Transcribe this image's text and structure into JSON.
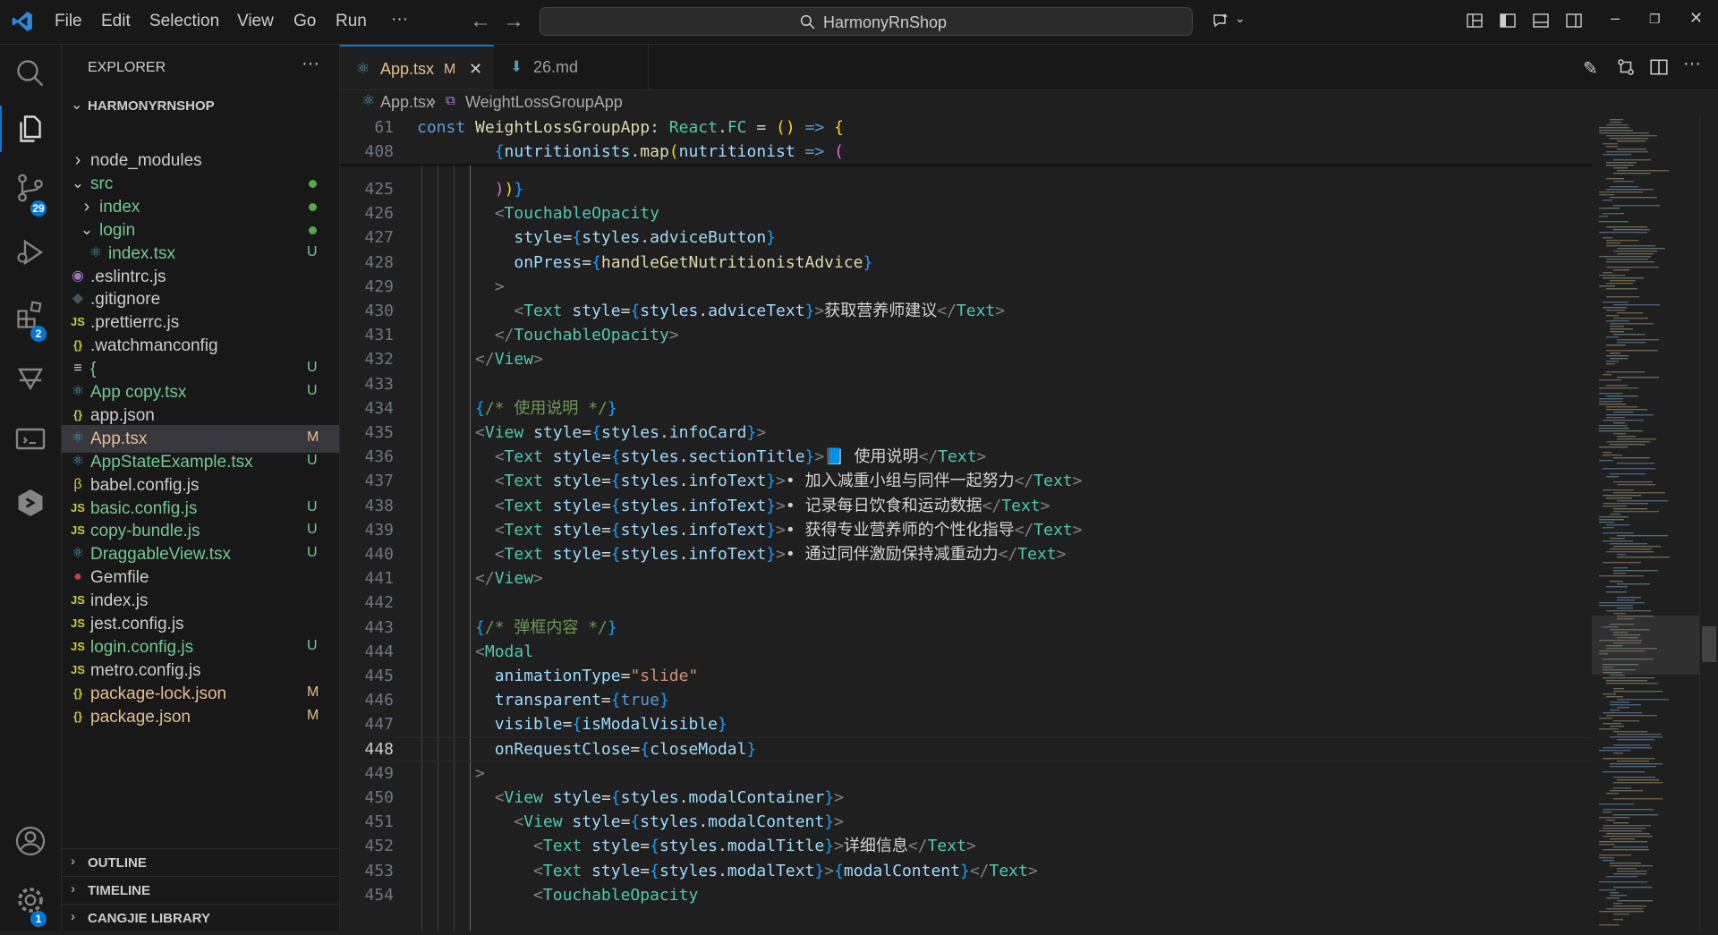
{
  "menu": [
    "File",
    "Edit",
    "Selection",
    "View",
    "Go",
    "Run",
    "···"
  ],
  "search": {
    "text": "HarmonyRnShop"
  },
  "activity_bar": {
    "scm_badge": "29",
    "extensions_badge": "2",
    "settings_badge": "1"
  },
  "explorer": {
    "title": "EXPLORER",
    "more": "···",
    "root": "HARMONYRNSHOP",
    "items": [
      {
        "name": "node_modules",
        "status": "",
        "indent": 1,
        "type": "folder-closed",
        "color": "#cccccc"
      },
      {
        "name": "src",
        "status": "dot",
        "indent": 1,
        "type": "folder-open",
        "color": "#73c991"
      },
      {
        "name": "index",
        "status": "dot",
        "indent": 2,
        "type": "folder-closed",
        "color": "#73c991"
      },
      {
        "name": "login",
        "status": "dot",
        "indent": 2,
        "type": "folder-open",
        "color": "#73c991"
      },
      {
        "name": "index.tsx",
        "status": "U",
        "indent": 3,
        "type": "tsx",
        "color": "#73c991"
      },
      {
        "name": ".eslintrc.js",
        "status": "",
        "indent": 1,
        "type": "eslint",
        "color": "#cccccc"
      },
      {
        "name": ".gitignore",
        "status": "",
        "indent": 1,
        "type": "git",
        "color": "#cccccc"
      },
      {
        "name": ".prettierrc.js",
        "status": "",
        "indent": 1,
        "type": "js",
        "color": "#cccccc"
      },
      {
        "name": ".watchmanconfig",
        "status": "",
        "indent": 1,
        "type": "json",
        "color": "#cccccc"
      },
      {
        "name": "{",
        "status": "U",
        "indent": 1,
        "type": "text",
        "color": "#73c991"
      },
      {
        "name": "App copy.tsx",
        "status": "U",
        "indent": 1,
        "type": "tsx",
        "color": "#73c991"
      },
      {
        "name": "app.json",
        "status": "",
        "indent": 1,
        "type": "json",
        "color": "#cccccc"
      },
      {
        "name": "App.tsx",
        "status": "M",
        "indent": 1,
        "type": "tsx",
        "color": "#e2c08d"
      },
      {
        "name": "AppStateExample.tsx",
        "status": "U",
        "indent": 1,
        "type": "tsx",
        "color": "#73c991"
      },
      {
        "name": "babel.config.js",
        "status": "",
        "indent": 1,
        "type": "babel",
        "color": "#cccccc"
      },
      {
        "name": "basic.config.js",
        "status": "U",
        "indent": 1,
        "type": "js",
        "color": "#73c991"
      },
      {
        "name": "copy-bundle.js",
        "status": "U",
        "indent": 1,
        "type": "js",
        "color": "#73c991"
      },
      {
        "name": "DraggableView.tsx",
        "status": "U",
        "indent": 1,
        "type": "tsx",
        "color": "#73c991"
      },
      {
        "name": "Gemfile",
        "status": "",
        "indent": 1,
        "type": "ruby",
        "color": "#cccccc"
      },
      {
        "name": "index.js",
        "status": "",
        "indent": 1,
        "type": "js",
        "color": "#cccccc"
      },
      {
        "name": "jest.config.js",
        "status": "",
        "indent": 1,
        "type": "js",
        "color": "#cccccc"
      },
      {
        "name": "login.config.js",
        "status": "U",
        "indent": 1,
        "type": "js",
        "color": "#73c991"
      },
      {
        "name": "metro.config.js",
        "status": "",
        "indent": 1,
        "type": "js",
        "color": "#cccccc"
      },
      {
        "name": "package-lock.json",
        "status": "M",
        "indent": 1,
        "type": "json",
        "color": "#e2c08d"
      },
      {
        "name": "package.json",
        "status": "M",
        "indent": 1,
        "type": "json",
        "color": "#e2c08d"
      }
    ],
    "sections": [
      "OUTLINE",
      "TIMELINE",
      "CANGJIE LIBRARY"
    ]
  },
  "tabs": [
    {
      "label": "App.tsx",
      "status": "M",
      "close": "✕"
    },
    {
      "label": "26.md"
    }
  ],
  "breadcrumb": {
    "file": "App.tsx",
    "symbol": "WeightLossGroupApp"
  },
  "sticky": [
    {
      "ln": "61",
      "html": "<span class='k'>const</span> <span class='fn'>WeightLossGroupApp</span><span class='txt'>: </span><span class='t'>React</span><span class='txt'>.</span><span class='t'>FC</span><span class='txt'> = </span><span class='br1'>()</span><span class='txt'> </span><span class='k'>=&gt;</span><span class='txt'> </span><span class='br1'>{</span>"
    },
    {
      "ln": "408",
      "html": "        <span class='br3'>{</span><span class='v'>nutritionists</span><span class='txt'>.</span><span class='fn'>map</span><span class='br1'>(</span><span class='v'>nutritionist</span><span class='txt'> </span><span class='k'>=&gt;</span><span class='txt'> </span><span class='br2'>(</span>"
    }
  ],
  "code": [
    {
      "ln": "425",
      "html": "        <span class='br2'>)</span><span class='br1'>)</span><span class='br3'>}</span>"
    },
    {
      "ln": "426",
      "html": "        <span class='p'>&lt;</span><span class='jt'>TouchableOpacity</span>"
    },
    {
      "ln": "427",
      "html": "          <span class='v'>style</span><span class='txt'>=</span><span class='br3'>{</span><span class='v'>styles</span><span class='txt'>.</span><span class='v'>adviceButton</span><span class='br3'>}</span>"
    },
    {
      "ln": "428",
      "html": "          <span class='v'>onPress</span><span class='txt'>=</span><span class='br3'>{</span><span class='fn'>handleGetNutritionistAdvice</span><span class='br3'>}</span>"
    },
    {
      "ln": "429",
      "html": "        <span class='p'>&gt;</span>"
    },
    {
      "ln": "430",
      "html": "          <span class='p'>&lt;</span><span class='jt'>Text</span> <span class='v'>style</span><span class='txt'>=</span><span class='br3'>{</span><span class='v'>styles</span><span class='txt'>.</span><span class='v'>adviceText</span><span class='br3'>}</span><span class='p'>&gt;</span><span class='txt'>获取营养师建议</span><span class='p'>&lt;/</span><span class='jt'>Text</span><span class='p'>&gt;</span>"
    },
    {
      "ln": "431",
      "html": "        <span class='p'>&lt;/</span><span class='jt'>TouchableOpacity</span><span class='p'>&gt;</span>"
    },
    {
      "ln": "432",
      "html": "      <span class='p'>&lt;/</span><span class='jt'>View</span><span class='p'>&gt;</span>"
    },
    {
      "ln": "433",
      "html": ""
    },
    {
      "ln": "434",
      "html": "      <span class='br3'>{</span><span class='c'>/* 使用说明 */</span><span class='br3'>}</span>"
    },
    {
      "ln": "435",
      "html": "      <span class='p'>&lt;</span><span class='jt'>View</span> <span class='v'>style</span><span class='txt'>=</span><span class='br3'>{</span><span class='v'>styles</span><span class='txt'>.</span><span class='v'>infoCard</span><span class='br3'>}</span><span class='p'>&gt;</span>"
    },
    {
      "ln": "436",
      "html": "        <span class='p'>&lt;</span><span class='jt'>Text</span> <span class='v'>style</span><span class='txt'>=</span><span class='br3'>{</span><span class='v'>styles</span><span class='txt'>.</span><span class='v'>sectionTitle</span><span class='br3'>}</span><span class='p'>&gt;</span><span class='br3'>📘</span><span class='txt'> 使用说明</span><span class='p'>&lt;/</span><span class='jt'>Text</span><span class='p'>&gt;</span>"
    },
    {
      "ln": "437",
      "html": "        <span class='p'>&lt;</span><span class='jt'>Text</span> <span class='v'>style</span><span class='txt'>=</span><span class='br3'>{</span><span class='v'>styles</span><span class='txt'>.</span><span class='v'>infoText</span><span class='br3'>}</span><span class='p'>&gt;</span><span class='txt'>• 加入减重小组与同伴一起努力</span><span class='p'>&lt;/</span><span class='jt'>Text</span><span class='p'>&gt;</span>"
    },
    {
      "ln": "438",
      "html": "        <span class='p'>&lt;</span><span class='jt'>Text</span> <span class='v'>style</span><span class='txt'>=</span><span class='br3'>{</span><span class='v'>styles</span><span class='txt'>.</span><span class='v'>infoText</span><span class='br3'>}</span><span class='p'>&gt;</span><span class='txt'>• 记录每日饮食和运动数据</span><span class='p'>&lt;/</span><span class='jt'>Text</span><span class='p'>&gt;</span>"
    },
    {
      "ln": "439",
      "html": "        <span class='p'>&lt;</span><span class='jt'>Text</span> <span class='v'>style</span><span class='txt'>=</span><span class='br3'>{</span><span class='v'>styles</span><span class='txt'>.</span><span class='v'>infoText</span><span class='br3'>}</span><span class='p'>&gt;</span><span class='txt'>• 获得专业营养师的个性化指导</span><span class='p'>&lt;/</span><span class='jt'>Text</span><span class='p'>&gt;</span>"
    },
    {
      "ln": "440",
      "html": "        <span class='p'>&lt;</span><span class='jt'>Text</span> <span class='v'>style</span><span class='txt'>=</span><span class='br3'>{</span><span class='v'>styles</span><span class='txt'>.</span><span class='v'>infoText</span><span class='br3'>}</span><span class='p'>&gt;</span><span class='txt'>• 通过同伴激励保持减重动力</span><span class='p'>&lt;/</span><span class='jt'>Text</span><span class='p'>&gt;</span>"
    },
    {
      "ln": "441",
      "html": "      <span class='p'>&lt;/</span><span class='jt'>View</span><span class='p'>&gt;</span>"
    },
    {
      "ln": "442",
      "html": ""
    },
    {
      "ln": "443",
      "html": "      <span class='br3'>{</span><span class='c'>/* 弹框内容 */</span><span class='br3'>}</span>"
    },
    {
      "ln": "444",
      "html": "      <span class='p'>&lt;</span><span class='jt'>Modal</span>"
    },
    {
      "ln": "445",
      "html": "        <span class='v'>animationType</span><span class='txt'>=</span><span class='s'>\"slide\"</span>"
    },
    {
      "ln": "446",
      "html": "        <span class='v'>transparent</span><span class='txt'>=</span><span class='br3'>{</span><span class='k'>true</span><span class='br3'>}</span>"
    },
    {
      "ln": "447",
      "html": "        <span class='v'>visible</span><span class='txt'>=</span><span class='br3'>{</span><span class='v'>isModalVisible</span><span class='br3'>}</span>"
    },
    {
      "ln": "448",
      "html": "        <span class='v'>onRequestClose</span><span class='txt'>=</span><span class='br3'>{</span><span class='v'>closeModal</span><span class='br3'>}</span>",
      "current": true
    },
    {
      "ln": "449",
      "html": "      <span class='p'>&gt;</span>"
    },
    {
      "ln": "450",
      "html": "        <span class='p'>&lt;</span><span class='jt'>View</span> <span class='v'>style</span><span class='txt'>=</span><span class='br3'>{</span><span class='v'>styles</span><span class='txt'>.</span><span class='v'>modalContainer</span><span class='br3'>}</span><span class='p'>&gt;</span>"
    },
    {
      "ln": "451",
      "html": "          <span class='p'>&lt;</span><span class='jt'>View</span> <span class='v'>style</span><span class='txt'>=</span><span class='br3'>{</span><span class='v'>styles</span><span class='txt'>.</span><span class='v'>modalContent</span><span class='br3'>}</span><span class='p'>&gt;</span>"
    },
    {
      "ln": "452",
      "html": "            <span class='p'>&lt;</span><span class='jt'>Text</span> <span class='v'>style</span><span class='txt'>=</span><span class='br3'>{</span><span class='v'>styles</span><span class='txt'>.</span><span class='v'>modalTitle</span><span class='br3'>}</span><span class='p'>&gt;</span><span class='txt'>详细信息</span><span class='p'>&lt;/</span><span class='jt'>Text</span><span class='p'>&gt;</span>"
    },
    {
      "ln": "453",
      "html": "            <span class='p'>&lt;</span><span class='jt'>Text</span> <span class='v'>style</span><span class='txt'>=</span><span class='br3'>{</span><span class='v'>styles</span><span class='txt'>.</span><span class='v'>modalText</span><span class='br3'>}</span><span class='p'>&gt;</span><span class='br3'>{</span><span class='v'>modalContent</span><span class='br3'>}</span><span class='p'>&lt;/</span><span class='jt'>Text</span><span class='p'>&gt;</span>"
    },
    {
      "ln": "454",
      "html": "            <span class='p'>&lt;</span><span class='jt'>TouchableOpacity</span>"
    }
  ]
}
